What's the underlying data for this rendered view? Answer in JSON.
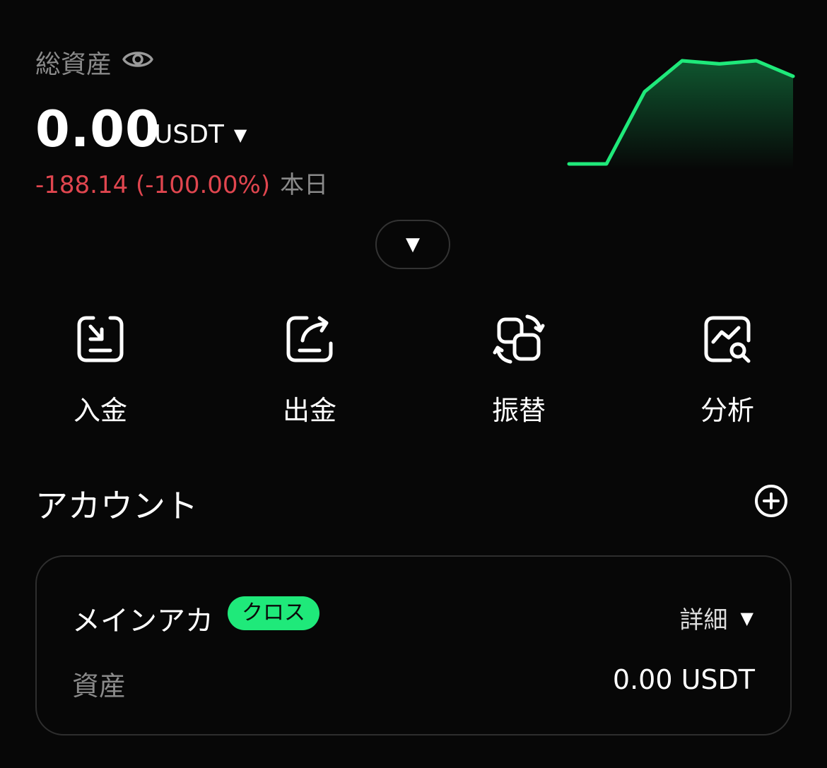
{
  "header": {
    "total_label": "総資産",
    "balance": "0.00",
    "currency": "USDT",
    "pnl_value": "-188.14 (-100.00%)",
    "pnl_period": "本日"
  },
  "sparkline": {
    "type": "line",
    "values": [
      0.0,
      0.0,
      0.7,
      1.0,
      0.97,
      1.0,
      0.85
    ],
    "color": "#1fe97a"
  },
  "actions": [
    {
      "label": "入金",
      "icon": "deposit-icon"
    },
    {
      "label": "出金",
      "icon": "withdraw-icon"
    },
    {
      "label": "振替",
      "icon": "transfer-icon"
    },
    {
      "label": "分析",
      "icon": "analysis-icon"
    }
  ],
  "accounts": {
    "title": "アカウント",
    "card": {
      "name": "メインアカ",
      "badge": "クロス",
      "detail_label": "詳細",
      "asset_label": "資産",
      "asset_value": "0.00 USDT"
    }
  },
  "colors": {
    "background": "#070707",
    "accent": "#1fe97a",
    "negative": "#e0464f",
    "muted": "#8a8a8a"
  }
}
